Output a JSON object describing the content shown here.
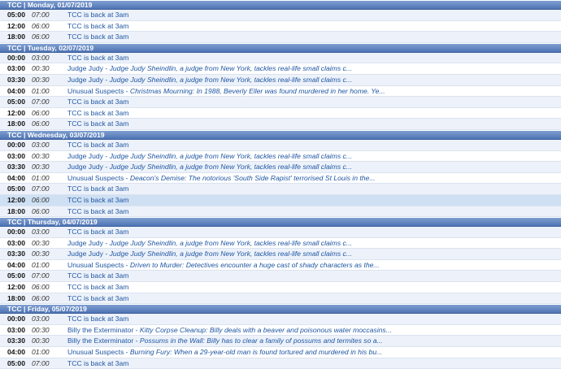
{
  "days": [
    {
      "header": "TCC | Monday, 01/07/2019",
      "rows": [
        {
          "time": "05:00",
          "duration": "07:00",
          "title": "TCC is back at 3am",
          "desc": ""
        },
        {
          "time": "12:00",
          "duration": "06:00",
          "title": "TCC is back at 3am",
          "desc": ""
        },
        {
          "time": "18:00",
          "duration": "06:00",
          "title": "TCC is back at 3am",
          "desc": ""
        }
      ]
    },
    {
      "header": "TCC | Tuesday, 02/07/2019",
      "rows": [
        {
          "time": "00:00",
          "duration": "03:00",
          "title": "TCC is back at 3am",
          "desc": ""
        },
        {
          "time": "03:00",
          "duration": "00:30",
          "title": "Judge Judy",
          "desc": "Judge Judy Sheindlin, a judge from New York, tackles real-life small claims c..."
        },
        {
          "time": "03:30",
          "duration": "00:30",
          "title": "Judge Judy",
          "desc": "Judge Judy Sheindlin, a judge from New York, tackles real-life small claims c..."
        },
        {
          "time": "04:00",
          "duration": "01:00",
          "title": "Unusual Suspects",
          "desc": "Christmas Mourning: In 1988, Beverly Eller was found murdered in her home. Ye..."
        },
        {
          "time": "05:00",
          "duration": "07:00",
          "title": "TCC is back at 3am",
          "desc": ""
        },
        {
          "time": "12:00",
          "duration": "06:00",
          "title": "TCC is back at 3am",
          "desc": ""
        },
        {
          "time": "18:00",
          "duration": "06:00",
          "title": "TCC is back at 3am",
          "desc": ""
        }
      ]
    },
    {
      "header": "TCC | Wednesday, 03/07/2019",
      "rows": [
        {
          "time": "00:00",
          "duration": "03:00",
          "title": "TCC is back at 3am",
          "desc": ""
        },
        {
          "time": "03:00",
          "duration": "00:30",
          "title": "Judge Judy",
          "desc": "Judge Judy Sheindlin, a judge from New York, tackles real-life small claims c..."
        },
        {
          "time": "03:30",
          "duration": "00:30",
          "title": "Judge Judy",
          "desc": "Judge Judy Sheindlin, a judge from New York, tackles real-life small claims c..."
        },
        {
          "time": "04:00",
          "duration": "01:00",
          "title": "Unusual Suspects",
          "desc": "Deacon's Demise: The notorious 'South Side Rapist' terrorised St Louis in the..."
        },
        {
          "time": "05:00",
          "duration": "07:00",
          "title": "TCC is back at 3am",
          "desc": ""
        },
        {
          "time": "12:00",
          "duration": "06:00",
          "title": "TCC is back at 3am",
          "desc": "",
          "highlight": true
        },
        {
          "time": "18:00",
          "duration": "06:00",
          "title": "TCC is back at 3am",
          "desc": ""
        }
      ]
    },
    {
      "header": "TCC | Thursday, 04/07/2019",
      "rows": [
        {
          "time": "00:00",
          "duration": "03:00",
          "title": "TCC is back at 3am",
          "desc": ""
        },
        {
          "time": "03:00",
          "duration": "00:30",
          "title": "Judge Judy",
          "desc": "Judge Judy Sheindlin, a judge from New York, tackles real-life small claims c..."
        },
        {
          "time": "03:30",
          "duration": "00:30",
          "title": "Judge Judy",
          "desc": "Judge Judy Sheindlin, a judge from New York, tackles real-life small claims c..."
        },
        {
          "time": "04:00",
          "duration": "01:00",
          "title": "Unusual Suspects",
          "desc": "Driven to Murder: Detectives encounter a huge cast of shady characters as the..."
        },
        {
          "time": "05:00",
          "duration": "07:00",
          "title": "TCC is back at 3am",
          "desc": ""
        },
        {
          "time": "12:00",
          "duration": "06:00",
          "title": "TCC is back at 3am",
          "desc": ""
        },
        {
          "time": "18:00",
          "duration": "06:00",
          "title": "TCC is back at 3am",
          "desc": ""
        }
      ]
    },
    {
      "header": "TCC | Friday, 05/07/2019",
      "rows": [
        {
          "time": "00:00",
          "duration": "03:00",
          "title": "TCC is back at 3am",
          "desc": ""
        },
        {
          "time": "03:00",
          "duration": "00:30",
          "title": "Billy the Exterminator",
          "desc": "Kitty Corpse Cleanup: Billy deals with a beaver and poisonous water moccasins..."
        },
        {
          "time": "03:30",
          "duration": "00:30",
          "title": "Billy the Exterminator",
          "desc": "Possums in the Wall: Billy has to clear a family of possums and termites so a..."
        },
        {
          "time": "04:00",
          "duration": "01:00",
          "title": "Unusual Suspects",
          "desc": "Burning Fury: When a 29-year-old man is found tortured and murdered in his bu..."
        },
        {
          "time": "05:00",
          "duration": "07:00",
          "title": "TCC is back at 3am",
          "desc": ""
        }
      ]
    }
  ],
  "separator": " - ",
  "colors": {
    "header": "#5a7fbf",
    "row_alt": "#edf2fa",
    "row_highlight": "#cfe0f3",
    "link": "#1f56a3"
  }
}
